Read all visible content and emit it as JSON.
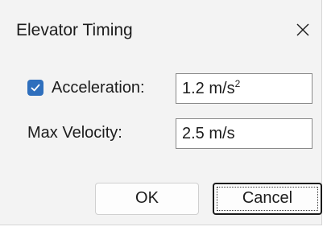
{
  "window": {
    "title": "Elevator Timing",
    "close_icon": "close-icon"
  },
  "form": {
    "acceleration": {
      "checked": true,
      "checkbox_icon": "checkmark-icon",
      "label": "Acceleration:",
      "value": "1.2 m/s",
      "value_superscript": "2"
    },
    "max_velocity": {
      "label": "Max Velocity:",
      "value": "2.5 m/s"
    }
  },
  "buttons": {
    "ok_label": "OK",
    "cancel_label": "Cancel"
  },
  "colors": {
    "dialog_background": "#f3f3f3",
    "checkbox_accent": "#2f6fbd",
    "field_background": "#ffffff"
  }
}
